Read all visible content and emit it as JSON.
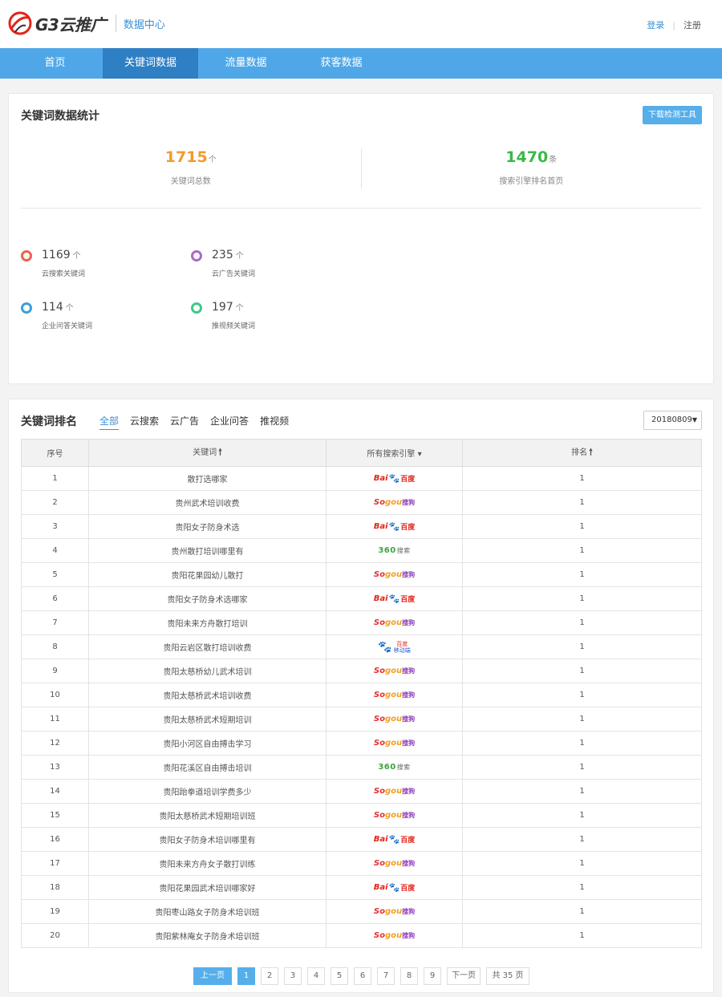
{
  "header": {
    "logo_text": "G3云推广",
    "subtitle": "数据中心",
    "login": "登录",
    "separator": "|",
    "register": "注册"
  },
  "nav": [
    {
      "label": "首页",
      "active": false
    },
    {
      "label": "关键词数据",
      "active": true
    },
    {
      "label": "流量数据",
      "active": false
    },
    {
      "label": "获客数据",
      "active": false
    }
  ],
  "stats": {
    "title": "关键词数据统计",
    "download_button": "下载检测工具",
    "total": {
      "value": "1715",
      "unit": "个",
      "label": "关键词总数"
    },
    "first_page": {
      "value": "1470",
      "unit": "条",
      "label": "搜索引擎排名首页"
    },
    "breakdown": [
      {
        "value": "1169",
        "unit": "个",
        "label": "云搜索关键词",
        "color": "#e8634a"
      },
      {
        "value": "235",
        "unit": "个",
        "label": "云广告关键词",
        "color": "#a86bc6"
      },
      {
        "value": "114",
        "unit": "个",
        "label": "企业问答关键词",
        "color": "#3b9fd8"
      },
      {
        "value": "197",
        "unit": "个",
        "label": "推视频关键词",
        "color": "#3dc98a"
      }
    ]
  },
  "ranking": {
    "title": "关键词排名",
    "filters": [
      "全部",
      "云搜索",
      "云广告",
      "企业问答",
      "推视频"
    ],
    "date": "20180809",
    "date_caret": "▼",
    "columns": {
      "index": "序号",
      "keyword": "关键词",
      "engine": "所有搜索引擎",
      "rank": "排名"
    },
    "sort_arrow": "🠕",
    "engine_caret": "▾",
    "rows": [
      {
        "index": "1",
        "keyword": "散打选哪家",
        "engine": "baidu",
        "rank": "1"
      },
      {
        "index": "2",
        "keyword": "贵州武术培训收费",
        "engine": "sogou",
        "rank": "1"
      },
      {
        "index": "3",
        "keyword": "贵阳女子防身术选",
        "engine": "baidu",
        "rank": "1"
      },
      {
        "index": "4",
        "keyword": "贵州散打培训哪里有",
        "engine": "360",
        "rank": "1"
      },
      {
        "index": "5",
        "keyword": "贵阳花果园幼儿散打",
        "engine": "sogou",
        "rank": "1"
      },
      {
        "index": "6",
        "keyword": "贵阳女子防身术选哪家",
        "engine": "baidu",
        "rank": "1"
      },
      {
        "index": "7",
        "keyword": "贵阳未来方舟散打培训",
        "engine": "sogou",
        "rank": "1"
      },
      {
        "index": "8",
        "keyword": "贵阳云岩区散打培训收费",
        "engine": "baidu-mobile",
        "rank": "1"
      },
      {
        "index": "9",
        "keyword": "贵阳太慈桥幼儿武术培训",
        "engine": "sogou",
        "rank": "1"
      },
      {
        "index": "10",
        "keyword": "贵阳太慈桥武术培训收费",
        "engine": "sogou",
        "rank": "1"
      },
      {
        "index": "11",
        "keyword": "贵阳太慈桥武术短期培训",
        "engine": "sogou",
        "rank": "1"
      },
      {
        "index": "12",
        "keyword": "贵阳小河区自由搏击学习",
        "engine": "sogou",
        "rank": "1"
      },
      {
        "index": "13",
        "keyword": "贵阳花溪区自由搏击培训",
        "engine": "360",
        "rank": "1"
      },
      {
        "index": "14",
        "keyword": "贵阳跆拳道培训学费多少",
        "engine": "sogou",
        "rank": "1"
      },
      {
        "index": "15",
        "keyword": "贵阳太慈桥武术短期培训班",
        "engine": "sogou",
        "rank": "1"
      },
      {
        "index": "16",
        "keyword": "贵阳女子防身术培训哪里有",
        "engine": "baidu",
        "rank": "1"
      },
      {
        "index": "17",
        "keyword": "贵阳未来方舟女子散打训练",
        "engine": "sogou",
        "rank": "1"
      },
      {
        "index": "18",
        "keyword": "贵阳花果园武术培训哪家好",
        "engine": "baidu",
        "rank": "1"
      },
      {
        "index": "19",
        "keyword": "贵阳枣山路女子防身术培训班",
        "engine": "sogou",
        "rank": "1"
      },
      {
        "index": "20",
        "keyword": "贵阳紫林庵女子防身术培训班",
        "engine": "sogou",
        "rank": "1"
      }
    ],
    "engines": {
      "baidu": {
        "a": "Bai",
        "b": "🐾",
        "c": "百度"
      },
      "sogou": {
        "a": "So",
        "b": "gou",
        "c": "搜狗"
      },
      "360": {
        "a": "360",
        "b": "搜索"
      },
      "baidu-mobile": {
        "a": "🐾",
        "b": "百度",
        "c": "移动端"
      }
    },
    "pager": {
      "prev": "上一页",
      "pages": [
        "1",
        "2",
        "3",
        "4",
        "5",
        "6",
        "7",
        "8",
        "9"
      ],
      "current": "1",
      "next": "下一页",
      "total": "共 35 页"
    }
  }
}
